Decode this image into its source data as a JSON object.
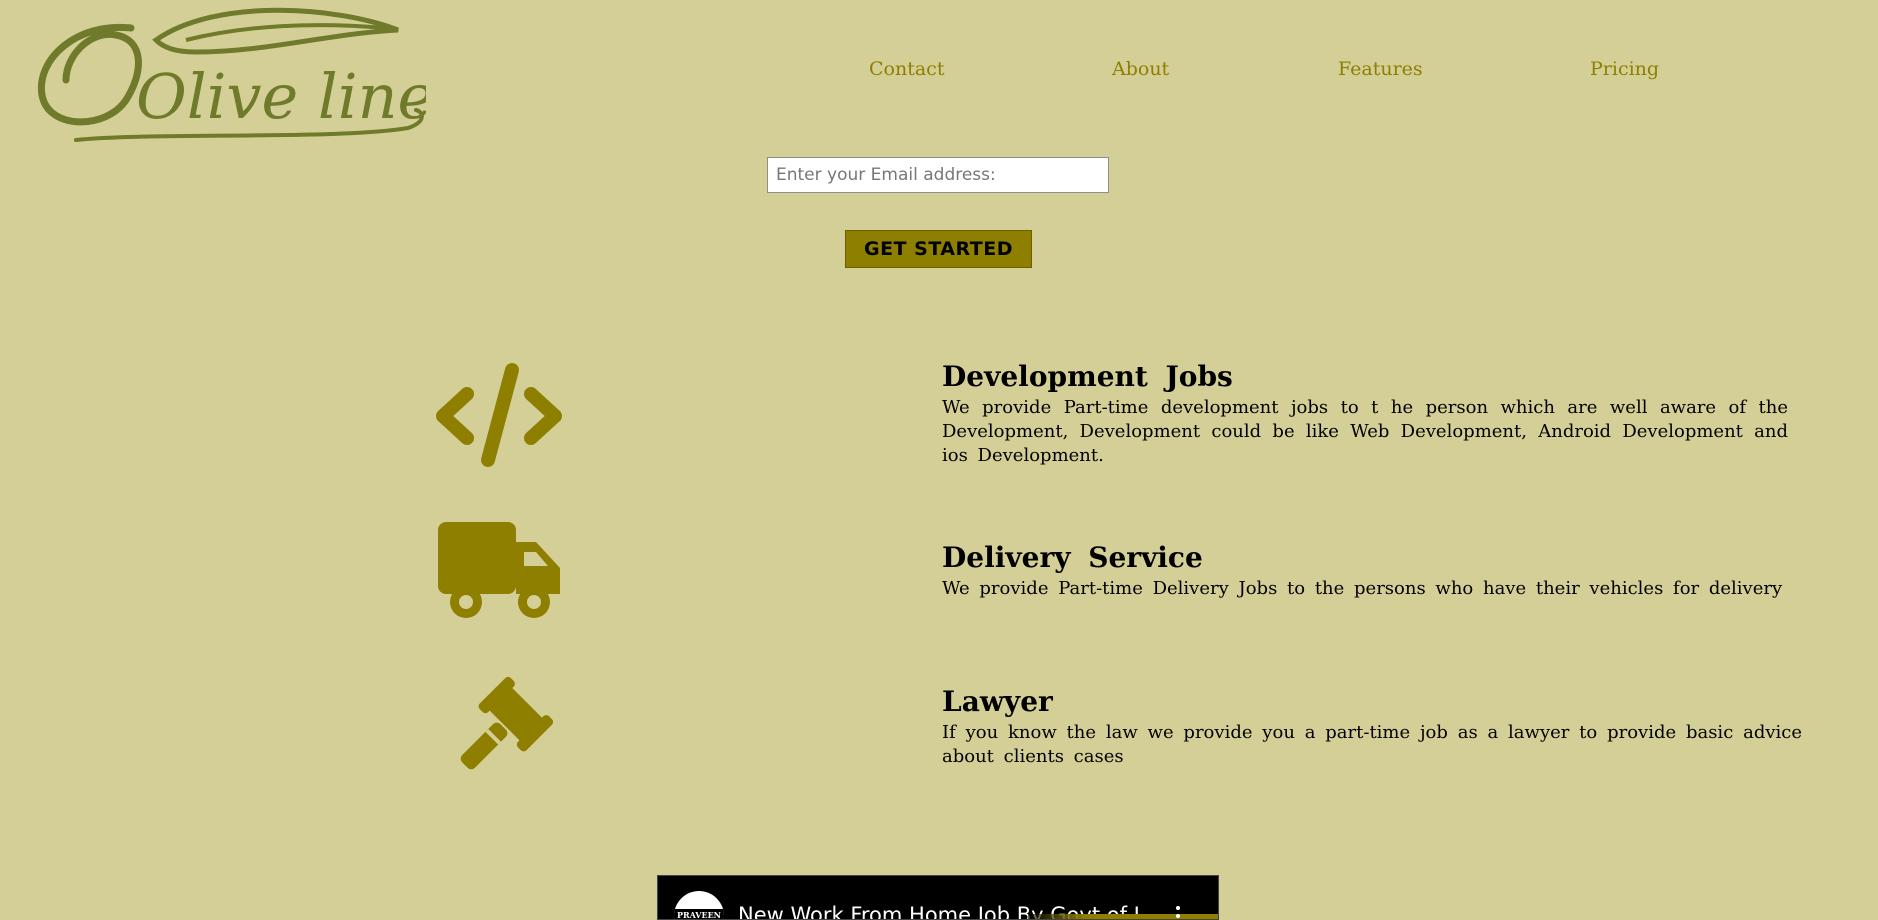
{
  "brand": {
    "logo_text": "Olive line",
    "logo_color": "#6f7a2a"
  },
  "nav": [
    {
      "label": "Contact"
    },
    {
      "label": "About"
    },
    {
      "label": "Features"
    },
    {
      "label": "Pricing"
    }
  ],
  "signup": {
    "email_placeholder": "Enter your Email address:",
    "email_value": "",
    "button_label": "GET STARTED"
  },
  "services": [
    {
      "icon": "code-icon",
      "title": "Development Jobs",
      "description": "We provide Part-time development jobs to t he person which are well aware of the Development, Development could be like Web Development, Android Development and ios Development."
    },
    {
      "icon": "truck-icon",
      "title": "Delivery Service",
      "description": "We provide Part-time Delivery Jobs to the persons who have their vehicles for delivery"
    },
    {
      "icon": "gavel-icon",
      "title": "Lawyer",
      "description": "If you know the law we provide you a part-time job as a lawyer to provide basic advice about clients cases"
    }
  ],
  "video": {
    "channel_badge": "PRAVEEN",
    "title": "New Work From Home Job By Govt of I..."
  },
  "colors": {
    "background": "#d4cf97",
    "accent": "#8e7f00",
    "text": "#000000"
  }
}
